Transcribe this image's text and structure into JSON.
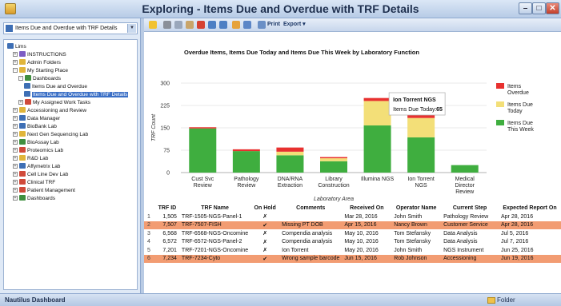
{
  "window": {
    "title": "Exploring - Items Due and Overdue with TRF Details"
  },
  "left_pane": {
    "dropdown_value": "Items Due and Overdue with TRF Details",
    "tree": [
      {
        "label": "Lims",
        "level": 0,
        "exp": "",
        "color": "#3e6fb5"
      },
      {
        "label": "INSTRUCTIONS",
        "level": 1,
        "exp": "+",
        "color": "#7c5cc4"
      },
      {
        "label": "Admin Folders",
        "level": 1,
        "exp": "+",
        "color": "#e0b53a"
      },
      {
        "label": "My Starting Place",
        "level": 1,
        "exp": "-",
        "color": "#e0b53a"
      },
      {
        "label": "Dashboards",
        "level": 2,
        "exp": "-",
        "color": "#3f8f3f"
      },
      {
        "label": "Items Due and Overdue",
        "level": 3,
        "exp": "",
        "color": "#3e6fb5"
      },
      {
        "label": "Items Due and Overdue with TRF Details",
        "level": 3,
        "exp": "",
        "color": "#3e6fb5",
        "selected": true
      },
      {
        "label": "My Assigned Work Tasks",
        "level": 2,
        "exp": "+",
        "color": "#d04a3a"
      },
      {
        "label": "Accessioning and Review",
        "level": 1,
        "exp": "+",
        "color": "#e0b53a"
      },
      {
        "label": "Data Manager",
        "level": 1,
        "exp": "+",
        "color": "#3e6fb5"
      },
      {
        "label": "BioBank Lab",
        "level": 1,
        "exp": "+",
        "color": "#3e6fb5"
      },
      {
        "label": "Next Gen Sequencing Lab",
        "level": 1,
        "exp": "+",
        "color": "#e0b53a"
      },
      {
        "label": "BioAssay Lab",
        "level": 1,
        "exp": "+",
        "color": "#3f8f3f"
      },
      {
        "label": "Proteomics Lab",
        "level": 1,
        "exp": "+",
        "color": "#d04a3a"
      },
      {
        "label": "R&D Lab",
        "level": 1,
        "exp": "+",
        "color": "#e0b53a"
      },
      {
        "label": "Affymetrix Lab",
        "level": 1,
        "exp": "+",
        "color": "#3e6fb5"
      },
      {
        "label": "Cell Line Dev Lab",
        "level": 1,
        "exp": "+",
        "color": "#d04a3a"
      },
      {
        "label": "Clinical TRF",
        "level": 1,
        "exp": "+",
        "color": "#d04a3a"
      },
      {
        "label": "Patient Management",
        "level": 1,
        "exp": "+",
        "color": "#d04a3a"
      },
      {
        "label": "Dashboards",
        "level": 1,
        "exp": "+",
        "color": "#3f8f3f"
      }
    ]
  },
  "toolbar": {
    "print_label": "Print",
    "export_label": "Export ▾"
  },
  "chart_data": {
    "type": "bar",
    "stacked": true,
    "title": "Overdue Items, Items Due Today and Items Due This Week by Laboratory Function",
    "xlabel": "Laboratory Area",
    "ylabel": "TRF Count",
    "ylim": [
      0,
      300
    ],
    "yticks": [
      "0",
      "75",
      "150",
      "225",
      "300"
    ],
    "categories": [
      "Cust Svc Review",
      "Pathology Review",
      "DNA/RNA Extraction",
      "Library Construction",
      "Illumina NGS",
      "Ion Torrent NGS",
      "Medical Director Review"
    ],
    "category_lines": [
      [
        "Cust Svc",
        "Review"
      ],
      [
        "Pathology",
        "Review"
      ],
      [
        "DNA/RNA",
        "Extraction"
      ],
      [
        "Library",
        "Construction"
      ],
      [
        "Illumina NGS"
      ],
      [
        "Ion Torrent",
        "NGS"
      ],
      [
        "Medical",
        "Director",
        "Review"
      ]
    ],
    "series": [
      {
        "name": "Items Due This Week",
        "legend_lines": [
          "Items Due",
          "This Week"
        ],
        "color": "#3fae3f",
        "values": [
          148,
          72,
          58,
          38,
          158,
          118,
          25
        ]
      },
      {
        "name": "Items Due Today",
        "legend_lines": [
          "Items Due",
          "Today"
        ],
        "color": "#f3df78",
        "values": [
          0,
          0,
          12,
          10,
          82,
          65,
          0
        ]
      },
      {
        "name": "Items Overdue",
        "legend_lines": [
          "Items",
          "Overdue"
        ],
        "color": "#e8312f",
        "values": [
          4,
          6,
          14,
          4,
          10,
          10,
          0
        ]
      }
    ],
    "legend_position": "right",
    "tooltip": {
      "title": "Ion Torrent NGS",
      "label": "Items Due Today:",
      "value": "65"
    }
  },
  "table": {
    "columns": [
      "",
      "TRF ID",
      "TRF Name",
      "On Hold",
      "Comments",
      "Received On",
      "Operator Name",
      "Current Step",
      "Expected Report On"
    ],
    "rows": [
      {
        "n": "1",
        "id": "1,505",
        "name": "TRF-1505-NGS-Panel-1",
        "hold": "✗",
        "comments": "",
        "received": "Mar 28, 2016",
        "operator": "John Smith",
        "step": "Pathology Review",
        "expected": "Apr 28, 2016",
        "hl": false
      },
      {
        "n": "2",
        "id": "7,507",
        "name": "TRF-7507-FISH",
        "hold": "✔",
        "comments": "Missing PT DOB",
        "received": "Apr 15, 2016",
        "operator": "Nancy Brown",
        "step": "Customer Service",
        "expected": "Apr 28, 2016",
        "hl": true
      },
      {
        "n": "3",
        "id": "6,568",
        "name": "TRF-6568-NGS-Oncomine",
        "hold": "✗",
        "comments": "Compendia analysis",
        "received": "May 10, 2016",
        "operator": "Tom Stefansky",
        "step": "Data Analysis",
        "expected": "Jul 5, 2016",
        "hl": false
      },
      {
        "n": "4",
        "id": "6,572",
        "name": "TRF-6572-NGS-Panel-2",
        "hold": "✗",
        "comments": "Compendia analysis",
        "received": "May 10, 2016",
        "operator": "Tom Stefansky",
        "step": "Data Analysis",
        "expected": "Jul 7, 2016",
        "hl": false
      },
      {
        "n": "5",
        "id": "7,201",
        "name": "TRF-7201-NGS-Oncomine",
        "hold": "✗",
        "comments": "Ion Torrent",
        "received": "May 20, 2016",
        "operator": "John Smith",
        "step": "NGS Instrument",
        "expected": "Jun 25, 2016",
        "hl": false
      },
      {
        "n": "6",
        "id": "7,234",
        "name": "TRF-7234-Cyto",
        "hold": "✔",
        "comments": "Wrong sample barcode",
        "received": "Jun 15, 2016",
        "operator": "Rob Johnson",
        "step": "Accessioning",
        "expected": "Jun 19, 2016",
        "hl": true
      }
    ]
  },
  "statusbar": {
    "left": "Nautilus Dashboard",
    "right": "Folder"
  }
}
